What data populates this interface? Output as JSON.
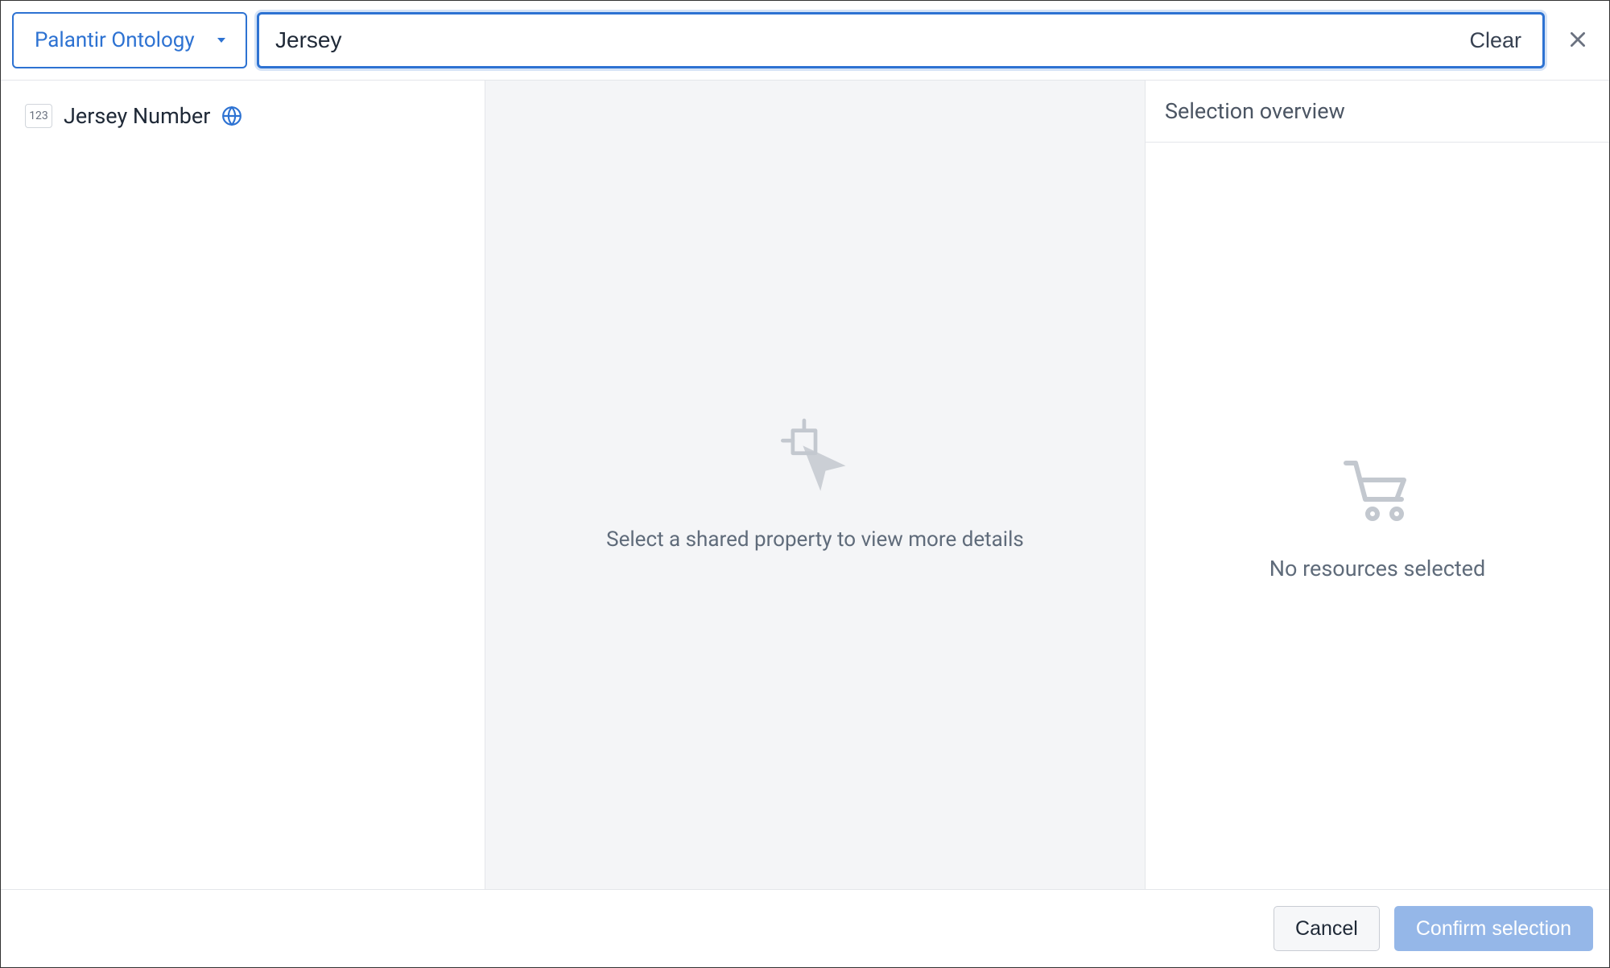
{
  "header": {
    "ontology_label": "Palantir Ontology",
    "search_value": "Jersey",
    "clear_label": "Clear"
  },
  "results": {
    "items": [
      {
        "type_badge": "123",
        "label": "Jersey Number"
      }
    ]
  },
  "detail": {
    "placeholder_msg": "Select a shared property to view more details"
  },
  "selection": {
    "header": "Selection overview",
    "empty_msg": "No resources selected"
  },
  "footer": {
    "cancel_label": "Cancel",
    "confirm_label": "Confirm selection"
  }
}
